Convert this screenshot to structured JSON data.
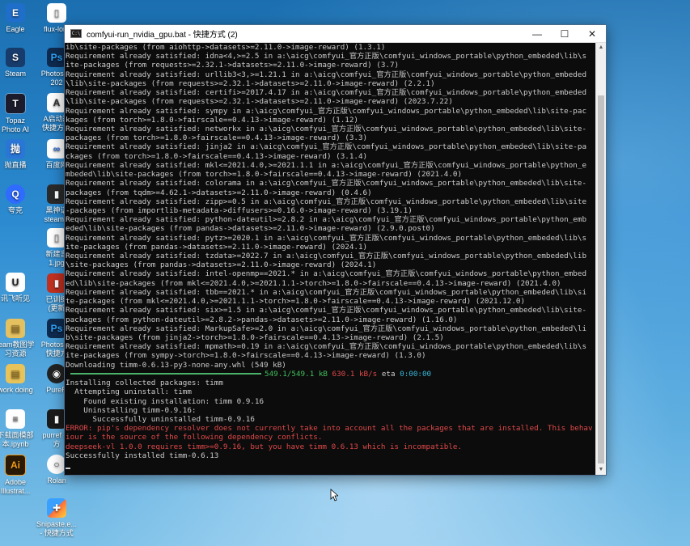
{
  "desktop": {
    "icons": [
      {
        "id": "eagle",
        "label": "Eagle",
        "color": "#1f6ec9",
        "glyph": "E"
      },
      {
        "id": "steam",
        "label": "Steam",
        "color": "#173b6b",
        "glyph": "S"
      },
      {
        "id": "topaz",
        "label": "Topaz Photo AI",
        "color": "#1b1b2b",
        "glyph": "T"
      },
      {
        "id": "live",
        "label": "抛直播",
        "color": "#2a76d6",
        "glyph": "抛"
      },
      {
        "id": "kuake",
        "label": "夸克",
        "color": "#2f6bff",
        "glyph": "Q"
      },
      {
        "id": "xunfei",
        "label": "讯飞听见",
        "color": "#ffffff",
        "glyph": "U"
      },
      {
        "id": "steam-resources",
        "label": "team教图学习资源",
        "color": "#e3c060",
        "glyph": "▤"
      },
      {
        "id": "work-doing",
        "label": "work doing",
        "color": "#e8c35a",
        "glyph": "▤"
      },
      {
        "id": "notebook",
        "label": "下载面模部本.ipynb",
        "color": "#ffffff",
        "glyph": "≡"
      },
      {
        "id": "illustrator",
        "label": "Adobe Illustrat...",
        "color": "#f29b1c",
        "glyph": "Ai"
      },
      {
        "id": "snipaste",
        "label": "Snipaste.e... - 快捷方式",
        "color": "#3aa0ff",
        "glyph": "✚"
      },
      {
        "id": "flux-lora",
        "label": "flux-lora",
        "color": "#ffffff",
        "glyph": "▯"
      },
      {
        "id": "photoshop-2024",
        "label": "Photosh - 202",
        "color": "#0e2a4e",
        "glyph": "Ps"
      },
      {
        "id": "ai-launcher",
        "label": "A启动器 快捷方式",
        "color": "#ffffff",
        "glyph": "A"
      },
      {
        "id": "baidu",
        "label": "百度网",
        "color": "#ffffff",
        "glyph": "∞"
      },
      {
        "id": "steamcity",
        "label": "黑神话 steamci",
        "color": "#2a2a2a",
        "glyph": "▮"
      },
      {
        "id": "new-jpg",
        "label": "新建言 1.jpg",
        "color": "#ffffff",
        "glyph": "▯"
      },
      {
        "id": "trained",
        "label": "已训练 (更新",
        "color": "#c03020",
        "glyph": "▮"
      },
      {
        "id": "photoshop-shortcut",
        "label": "Photosh - 快捷方",
        "color": "#0e2a4e",
        "glyph": "Ps"
      },
      {
        "id": "pureref",
        "label": "PureR",
        "color": "#222222",
        "glyph": "◉"
      },
      {
        "id": "purref-shortcut",
        "label": "purref 捷方",
        "color": "#1b1b1b",
        "glyph": "▮"
      },
      {
        "id": "rolan",
        "label": "Rolan",
        "color": "#ffffff",
        "glyph": "○"
      }
    ]
  },
  "window": {
    "title": "comfyui-run_nvidia_gpu.bat - 快捷方式 (2)",
    "app_icon": "C:\\",
    "minimize_glyph": "—",
    "maximize_glyph": "☐",
    "close_glyph": "✕"
  },
  "console": {
    "lines": [
      "ib\\site-packages (from aiohttp->datasets>=2.11.0->image-reward) (1.3.1)",
      "Requirement already satisfied: idna<4,>=2.5 in a:\\aicg\\comfyui_官方正版\\comfyui_windows_portable\\python_embeded\\lib\\s",
      "ite-packages (from requests>=2.32.1->datasets>=2.11.0->image-reward) (3.7)",
      "Requirement already satisfied: urllib3<3,>=1.21.1 in a:\\aicg\\comfyui_官方正版\\comfyui_windows_portable\\python_embeded",
      "\\lib\\site-packages (from requests>=2.32.1->datasets>=2.11.0->image-reward) (2.2.1)",
      "Requirement already satisfied: certifi>=2017.4.17 in a:\\aicg\\comfyui_官方正版\\comfyui_windows_portable\\python_embeded",
      "\\lib\\site-packages (from requests>=2.32.1->datasets>=2.11.0->image-reward) (2023.7.22)",
      "Requirement already satisfied: sympy in a:\\aicg\\comfyui_官方正版\\comfyui_windows_portable\\python_embeded\\lib\\site-pac",
      "kages (from torch>=1.8.0->fairscale==0.4.13->image-reward) (1.12)",
      "Requirement already satisfied: networkx in a:\\aicg\\comfyui_官方正版\\comfyui_windows_portable\\python_embeded\\lib\\site-",
      "packages (from torch>=1.8.0->fairscale==0.4.13->image-reward) (3.3)",
      "Requirement already satisfied: jinja2 in a:\\aicg\\comfyui_官方正版\\comfyui_windows_portable\\python_embeded\\lib\\site-pa",
      "ckages (from torch>=1.8.0->fairscale==0.4.13->image-reward) (3.1.4)",
      "Requirement already satisfied: mkl<=2021.4.0,>=2021.1.1 in a:\\aicg\\comfyui_官方正版\\comfyui_windows_portable\\python_e",
      "mbeded\\lib\\site-packages (from torch>=1.8.0->fairscale==0.4.13->image-reward) (2021.4.0)",
      "Requirement already satisfied: colorama in a:\\aicg\\comfyui_官方正版\\comfyui_windows_portable\\python_embeded\\lib\\site-",
      "packages (from tqdm>=4.62.1->datasets>=2.11.0->image-reward) (0.4.6)",
      "Requirement already satisfied: zipp>=0.5 in a:\\aicg\\comfyui_官方正版\\comfyui_windows_portable\\python_embeded\\lib\\site",
      "-packages (from importlib-metadata->diffusers>=0.16.0->image-reward) (3.19.1)",
      "Requirement already satisfied: python-dateutil>=2.8.2 in a:\\aicg\\comfyui_官方正版\\comfyui_windows_portable\\python_emb",
      "eded\\lib\\site-packages (from pandas->datasets>=2.11.0->image-reward) (2.9.0.post0)",
      "Requirement already satisfied: pytz>=2020.1 in a:\\aicg\\comfyui_官方正版\\comfyui_windows_portable\\python_embeded\\lib\\s",
      "ite-packages (from pandas->datasets>=2.11.0->image-reward) (2024.1)",
      "Requirement already satisfied: tzdata>=2022.7 in a:\\aicg\\comfyui_官方正版\\comfyui_windows_portable\\python_embeded\\lib",
      "\\site-packages (from pandas->datasets>=2.11.0->image-reward) (2024.1)",
      "Requirement already satisfied: intel-openmp==2021.* in a:\\aicg\\comfyui_官方正版\\comfyui_windows_portable\\python_embed",
      "ed\\lib\\site-packages (from mkl<=2021.4.0,>=2021.1.1->torch>=1.8.0->fairscale==0.4.13->image-reward) (2021.4.0)",
      "Requirement already satisfied: tbb==2021.* in a:\\aicg\\comfyui_官方正版\\comfyui_windows_portable\\python_embeded\\lib\\si",
      "te-packages (from mkl<=2021.4.0,>=2021.1.1->torch>=1.8.0->fairscale==0.4.13->image-reward) (2021.12.0)",
      "Requirement already satisfied: six>=1.5 in a:\\aicg\\comfyui_官方正版\\comfyui_windows_portable\\python_embeded\\lib\\site-",
      "packages (from python-dateutil>=2.8.2->pandas->datasets>=2.11.0->image-reward) (1.16.0)",
      "Requirement already satisfied: MarkupSafe>=2.0 in a:\\aicg\\comfyui_官方正版\\comfyui_windows_portable\\python_embeded\\li",
      "b\\site-packages (from jinja2->torch>=1.8.0->fairscale==0.4.13->image-reward) (2.1.5)",
      "Requirement already satisfied: mpmath>=0.19 in a:\\aicg\\comfyui_官方正版\\comfyui_windows_portable\\python_embeded\\lib\\s",
      "ite-packages (from sympy->torch>=1.8.0->fairscale==0.4.13->image-reward) (1.3.0)",
      "Downloading timm-0.6.13-py3-none-any.whl (549 kB)"
    ],
    "progress": {
      "done_fraction": 1.0,
      "size": "549.1/549.1 kB",
      "rate": "630.1 kB/s",
      "eta_label": "eta",
      "eta": "0:00:00"
    },
    "after_lines": [
      "Installing collected packages: timm",
      "  Attempting uninstall: timm",
      "    Found existing installation: timm 0.9.16",
      "    Uninstalling timm-0.9.16:",
      "      Successfully uninstalled timm-0.9.16"
    ],
    "error_lines": [
      "ERROR: pip's dependency resolver does not currently take into account all the packages that are installed. This behav",
      "iour is the source of the following dependency conflicts.",
      "deepseek-vl 1.0.0 requires timm>=0.9.16, but you have timm 0.6.13 which is incompatible."
    ],
    "final_line": "Successfully installed timm-0.6.13"
  }
}
